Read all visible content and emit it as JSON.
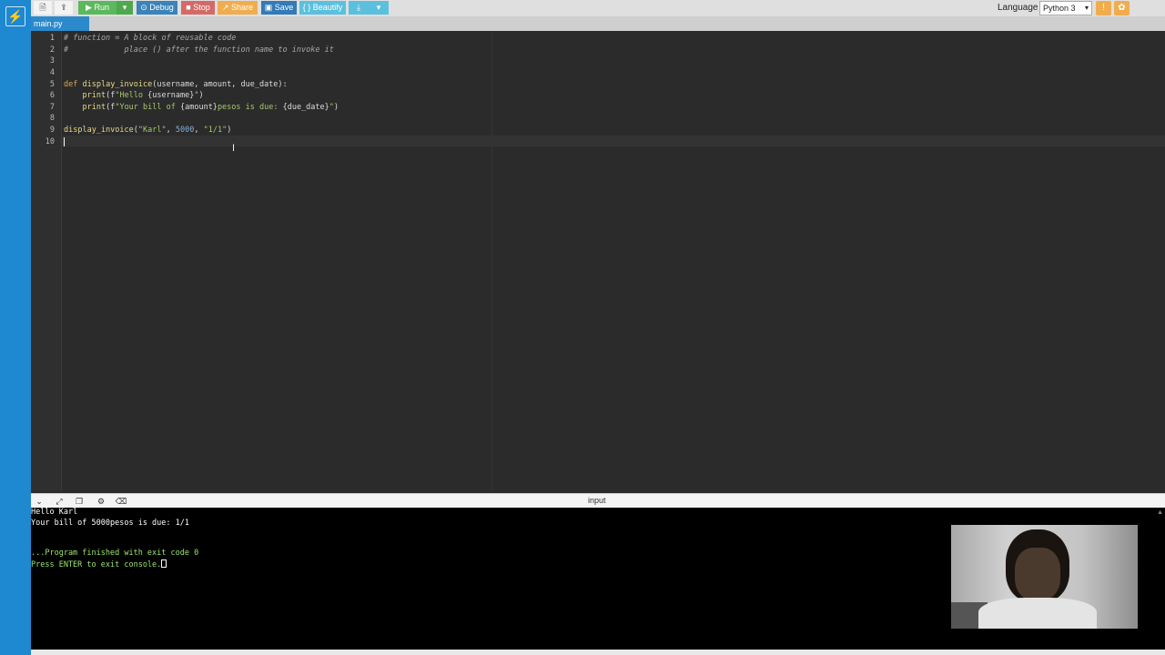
{
  "toolbar": {
    "run_label": "Run",
    "debug_label": "Debug",
    "stop_label": "Stop",
    "share_label": "Share",
    "save_label": "Save",
    "beautify_label": "{ } Beautify",
    "language_label": "Language",
    "language_value": "Python 3",
    "icons": {
      "new_file": "file-icon",
      "upload": "upload-icon",
      "run": "play-icon",
      "debug": "bug-icon",
      "stop": "stop-icon",
      "share": "share-icon",
      "save": "floppy-icon",
      "download": "download-icon",
      "info": "info-icon",
      "settings": "gear-icon"
    }
  },
  "tabs": [
    {
      "label": "main.py"
    }
  ],
  "editor": {
    "line_numbers": [
      "1",
      "2",
      "3",
      "4",
      "5",
      "6",
      "7",
      "8",
      "9",
      "10"
    ],
    "lines": {
      "l1": "# function = A block of reusable code",
      "l2": "#            place () after the function name to invoke it",
      "l5_kw": "def",
      "l5_fn": "display_invoice",
      "l5_rest": "(username, amount, due_date):",
      "l6_fn": "print",
      "l6_open": "(f",
      "l6_str1": "\"Hello ",
      "l6_expr": "{username}",
      "l6_str2": "\"",
      "l6_close": ")",
      "l7_fn": "print",
      "l7_open": "(f",
      "l7_str1": "\"Your bill of ",
      "l7_expr1": "{amount}",
      "l7_str2": "pesos is due: ",
      "l7_expr2": "{due_date}",
      "l7_str3": "\"",
      "l7_close": ")",
      "l9_fn": "display_invoice",
      "l9_open": "(",
      "l9_arg1": "\"Karl\"",
      "l9_sep1": ", ",
      "l9_arg2": "5000",
      "l9_sep2": ", ",
      "l9_arg3": "\"1/1\"",
      "l9_close": ")"
    }
  },
  "console": {
    "title": "input",
    "lines": [
      "Hello Karl",
      "Your bill of 5000pesos is due: 1/1",
      "",
      "",
      "...Program finished with exit code 0",
      "Press ENTER to exit console."
    ]
  },
  "colors": {
    "accent": "#1e88d0",
    "run": "#5cb85c",
    "debug": "#3b83b8",
    "stop": "#d36a68",
    "share": "#f0ad4e",
    "save": "#337ab7",
    "beautify": "#5bc0de"
  }
}
